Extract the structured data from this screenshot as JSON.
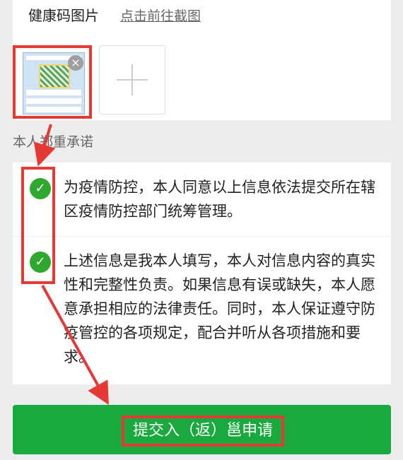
{
  "health_code": {
    "label": "健康码图片",
    "link": "点击前往截图",
    "remove_icon": "×"
  },
  "section_title": "本人郑重承诺",
  "promises": [
    "为疫情防控，本人同意以上信息依法提交所在辖区疫情防控部门统筹管理。",
    "上述信息是我本人填写，本人对信息内容的真实性和完整性负责。如果信息有误或缺失，本人愿意承担相应的法律责任。同时，本人保证遵守防疫管控的各项规定，配合并听从各项措施和要求。"
  ],
  "check_icon": "✓",
  "submit_label": "提交入（返）邕申请",
  "colors": {
    "accent_green": "#19a93f",
    "annotation_red": "#e53935"
  }
}
